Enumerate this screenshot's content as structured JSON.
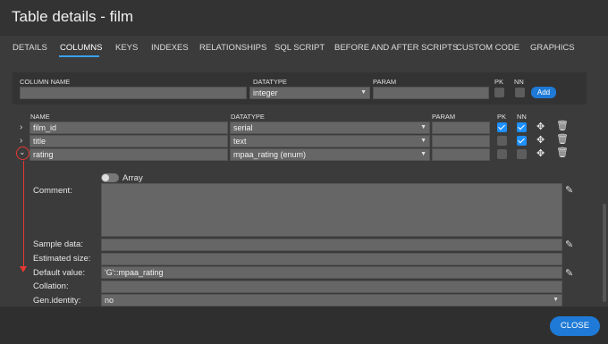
{
  "window": {
    "title": "Table details - film"
  },
  "tabs": [
    "DETAILS",
    "COLUMNS",
    "KEYS",
    "INDEXES",
    "RELATIONSHIPS",
    "SQL SCRIPT",
    "BEFORE AND AFTER SCRIPTS",
    "CUSTOM CODE",
    "GRAPHICS"
  ],
  "active_tab": "COLUMNS",
  "new_column": {
    "headers": {
      "name": "COLUMN NAME",
      "datatype": "DATATYPE",
      "param": "PARAM",
      "pk": "PK",
      "nn": "NN"
    },
    "name_value": "",
    "datatype_value": "integer",
    "param_value": "",
    "pk": false,
    "nn": false,
    "add_label": "Add"
  },
  "columns_table": {
    "headers": {
      "name": "NAME",
      "datatype": "DATATYPE",
      "param": "PARAM",
      "pk": "PK",
      "nn": "NN"
    },
    "rows": [
      {
        "name": "film_id",
        "datatype": "serial",
        "param": "",
        "pk": true,
        "nn": true,
        "expanded": false
      },
      {
        "name": "title",
        "datatype": "text",
        "param": "",
        "pk": false,
        "nn": true,
        "expanded": false
      },
      {
        "name": "rating",
        "datatype": "mpaa_rating (enum)",
        "param": "",
        "pk": false,
        "nn": false,
        "expanded": true
      }
    ]
  },
  "detail": {
    "array_label": "Array",
    "array_on": false,
    "comment_label": "Comment:",
    "comment_value": "",
    "sample_label": "Sample data:",
    "sample_value": "",
    "estimated_label": "Estimated size:",
    "estimated_value": "",
    "default_label": "Default value:",
    "default_value": "'G'::mpaa_rating",
    "collation_label": "Collation:",
    "collation_value": "",
    "genidentity_label": "Gen.identity:",
    "genidentity_value": "no"
  },
  "footer": {
    "close_label": "CLOSE"
  },
  "colors": {
    "accent": "#1e7ad6",
    "annotation": "#e53935",
    "background": "#3b3b3b"
  },
  "icons": [
    "chevron-right-icon",
    "chevron-down-icon",
    "move-icon",
    "trash-icon",
    "pencil-icon"
  ]
}
